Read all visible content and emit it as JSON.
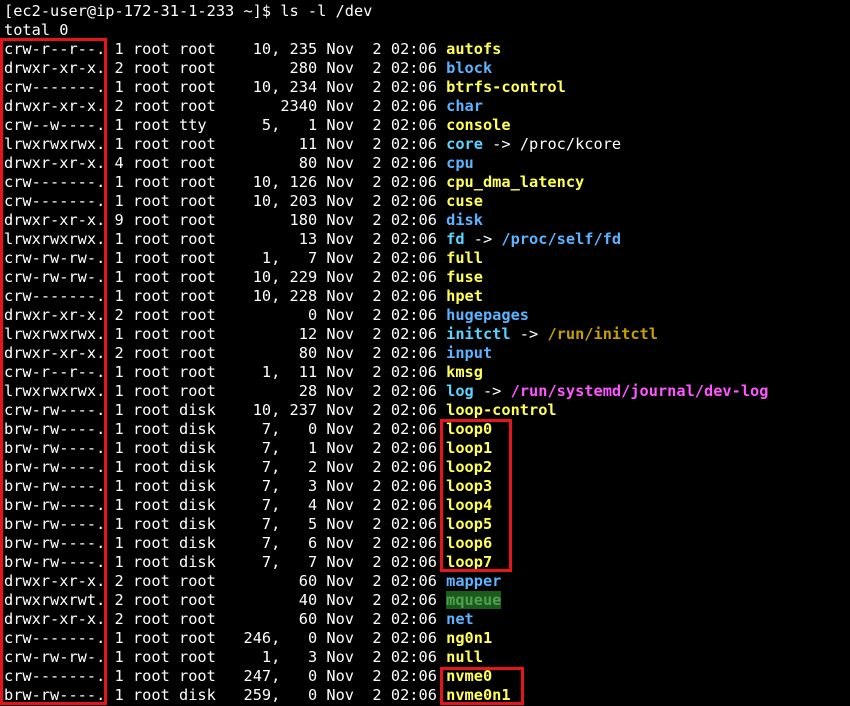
{
  "terminal": {
    "prompt": "[ec2-user@ip-172-31-1-233 ~]$ ls -l /dev",
    "total": "total 0",
    "entries": [
      {
        "perm": "crw-r--r--.",
        "links": "1",
        "owner": "root",
        "group": "root",
        "size": "10, 235",
        "month": "Nov",
        "day": "2",
        "time": "02:06",
        "name": "autofs",
        "kind": "yellow"
      },
      {
        "perm": "drwxr-xr-x.",
        "links": "2",
        "owner": "root",
        "group": "root",
        "size": "280",
        "month": "Nov",
        "day": "2",
        "time": "02:06",
        "name": "block",
        "kind": "blue"
      },
      {
        "perm": "crw-------.",
        "links": "1",
        "owner": "root",
        "group": "root",
        "size": "10, 234",
        "month": "Nov",
        "day": "2",
        "time": "02:06",
        "name": "btrfs-control",
        "kind": "yellow"
      },
      {
        "perm": "drwxr-xr-x.",
        "links": "2",
        "owner": "root",
        "group": "root",
        "size": "2340",
        "month": "Nov",
        "day": "2",
        "time": "02:06",
        "name": "char",
        "kind": "blue"
      },
      {
        "perm": "crw--w----.",
        "links": "1",
        "owner": "root",
        "group": "tty",
        "size": "5,   1",
        "month": "Nov",
        "day": "2",
        "time": "02:06",
        "name": "console",
        "kind": "yellow"
      },
      {
        "perm": "lrwxrwxrwx.",
        "links": "1",
        "owner": "root",
        "group": "root",
        "size": "11",
        "month": "Nov",
        "day": "2",
        "time": "02:06",
        "name": "core",
        "kind": "cyan",
        "arrow": " -> ",
        "target": "/proc/kcore",
        "target_kind": "white"
      },
      {
        "perm": "drwxr-xr-x.",
        "links": "4",
        "owner": "root",
        "group": "root",
        "size": "80",
        "month": "Nov",
        "day": "2",
        "time": "02:06",
        "name": "cpu",
        "kind": "blue"
      },
      {
        "perm": "crw-------.",
        "links": "1",
        "owner": "root",
        "group": "root",
        "size": "10, 126",
        "month": "Nov",
        "day": "2",
        "time": "02:06",
        "name": "cpu_dma_latency",
        "kind": "yellow"
      },
      {
        "perm": "crw-------.",
        "links": "1",
        "owner": "root",
        "group": "root",
        "size": "10, 203",
        "month": "Nov",
        "day": "2",
        "time": "02:06",
        "name": "cuse",
        "kind": "yellow"
      },
      {
        "perm": "drwxr-xr-x.",
        "links": "9",
        "owner": "root",
        "group": "root",
        "size": "180",
        "month": "Nov",
        "day": "2",
        "time": "02:06",
        "name": "disk",
        "kind": "blue"
      },
      {
        "perm": "lrwxrwxrwx.",
        "links": "1",
        "owner": "root",
        "group": "root",
        "size": "13",
        "month": "Nov",
        "day": "2",
        "time": "02:06",
        "name": "fd",
        "kind": "cyan",
        "arrow": " -> ",
        "target": "/proc/self/fd",
        "target_kind": "blue"
      },
      {
        "perm": "crw-rw-rw-.",
        "links": "1",
        "owner": "root",
        "group": "root",
        "size": "1,   7",
        "month": "Nov",
        "day": "2",
        "time": "02:06",
        "name": "full",
        "kind": "yellow"
      },
      {
        "perm": "crw-rw-rw-.",
        "links": "1",
        "owner": "root",
        "group": "root",
        "size": "10, 229",
        "month": "Nov",
        "day": "2",
        "time": "02:06",
        "name": "fuse",
        "kind": "yellow"
      },
      {
        "perm": "crw-------.",
        "links": "1",
        "owner": "root",
        "group": "root",
        "size": "10, 228",
        "month": "Nov",
        "day": "2",
        "time": "02:06",
        "name": "hpet",
        "kind": "yellow"
      },
      {
        "perm": "drwxr-xr-x.",
        "links": "2",
        "owner": "root",
        "group": "root",
        "size": "0",
        "month": "Nov",
        "day": "2",
        "time": "02:06",
        "name": "hugepages",
        "kind": "blue"
      },
      {
        "perm": "lrwxrwxrwx.",
        "links": "1",
        "owner": "root",
        "group": "root",
        "size": "12",
        "month": "Nov",
        "day": "2",
        "time": "02:06",
        "name": "initctl",
        "kind": "cyan",
        "arrow": " -> ",
        "target": "/run/initctl",
        "target_kind": "olive"
      },
      {
        "perm": "drwxr-xr-x.",
        "links": "2",
        "owner": "root",
        "group": "root",
        "size": "80",
        "month": "Nov",
        "day": "2",
        "time": "02:06",
        "name": "input",
        "kind": "blue"
      },
      {
        "perm": "crw-r--r--.",
        "links": "1",
        "owner": "root",
        "group": "root",
        "size": "1,  11",
        "month": "Nov",
        "day": "2",
        "time": "02:06",
        "name": "kmsg",
        "kind": "yellow"
      },
      {
        "perm": "lrwxrwxrwx.",
        "links": "1",
        "owner": "root",
        "group": "root",
        "size": "28",
        "month": "Nov",
        "day": "2",
        "time": "02:06",
        "name": "log",
        "kind": "cyan",
        "arrow": " -> ",
        "target": "/run/systemd/journal/dev-log",
        "target_kind": "magenta"
      },
      {
        "perm": "crw-rw----.",
        "links": "1",
        "owner": "root",
        "group": "disk",
        "size": "10, 237",
        "month": "Nov",
        "day": "2",
        "time": "02:06",
        "name": "loop-control",
        "kind": "yellow"
      },
      {
        "perm": "brw-rw----.",
        "links": "1",
        "owner": "root",
        "group": "disk",
        "size": "7,   0",
        "month": "Nov",
        "day": "2",
        "time": "02:06",
        "name": "loop0",
        "kind": "yellow"
      },
      {
        "perm": "brw-rw----.",
        "links": "1",
        "owner": "root",
        "group": "disk",
        "size": "7,   1",
        "month": "Nov",
        "day": "2",
        "time": "02:06",
        "name": "loop1",
        "kind": "yellow"
      },
      {
        "perm": "brw-rw----.",
        "links": "1",
        "owner": "root",
        "group": "disk",
        "size": "7,   2",
        "month": "Nov",
        "day": "2",
        "time": "02:06",
        "name": "loop2",
        "kind": "yellow"
      },
      {
        "perm": "brw-rw----.",
        "links": "1",
        "owner": "root",
        "group": "disk",
        "size": "7,   3",
        "month": "Nov",
        "day": "2",
        "time": "02:06",
        "name": "loop3",
        "kind": "yellow"
      },
      {
        "perm": "brw-rw----.",
        "links": "1",
        "owner": "root",
        "group": "disk",
        "size": "7,   4",
        "month": "Nov",
        "day": "2",
        "time": "02:06",
        "name": "loop4",
        "kind": "yellow"
      },
      {
        "perm": "brw-rw----.",
        "links": "1",
        "owner": "root",
        "group": "disk",
        "size": "7,   5",
        "month": "Nov",
        "day": "2",
        "time": "02:06",
        "name": "loop5",
        "kind": "yellow"
      },
      {
        "perm": "brw-rw----.",
        "links": "1",
        "owner": "root",
        "group": "disk",
        "size": "7,   6",
        "month": "Nov",
        "day": "2",
        "time": "02:06",
        "name": "loop6",
        "kind": "yellow"
      },
      {
        "perm": "brw-rw----.",
        "links": "1",
        "owner": "root",
        "group": "disk",
        "size": "7,   7",
        "month": "Nov",
        "day": "2",
        "time": "02:06",
        "name": "loop7",
        "kind": "yellow"
      },
      {
        "perm": "drwxr-xr-x.",
        "links": "2",
        "owner": "root",
        "group": "root",
        "size": "60",
        "month": "Nov",
        "day": "2",
        "time": "02:06",
        "name": "mapper",
        "kind": "blue"
      },
      {
        "perm": "drwxrwxrwt.",
        "links": "2",
        "owner": "root",
        "group": "root",
        "size": "40",
        "month": "Nov",
        "day": "2",
        "time": "02:06",
        "name": "mqueue",
        "kind": "mqueue"
      },
      {
        "perm": "drwxr-xr-x.",
        "links": "2",
        "owner": "root",
        "group": "root",
        "size": "60",
        "month": "Nov",
        "day": "2",
        "time": "02:06",
        "name": "net",
        "kind": "blue"
      },
      {
        "perm": "crw-------.",
        "links": "1",
        "owner": "root",
        "group": "root",
        "size": "246,   0",
        "month": "Nov",
        "day": "2",
        "time": "02:06",
        "name": "ng0n1",
        "kind": "yellow"
      },
      {
        "perm": "crw-rw-rw-.",
        "links": "1",
        "owner": "root",
        "group": "root",
        "size": "1,   3",
        "month": "Nov",
        "day": "2",
        "time": "02:06",
        "name": "null",
        "kind": "yellow"
      },
      {
        "perm": "crw-------.",
        "links": "1",
        "owner": "root",
        "group": "root",
        "size": "247,   0",
        "month": "Nov",
        "day": "2",
        "time": "02:06",
        "name": "nvme0",
        "kind": "yellow"
      },
      {
        "perm": "brw-rw----.",
        "links": "1",
        "owner": "root",
        "group": "disk",
        "size": "259,   0",
        "month": "Nov",
        "day": "2",
        "time": "02:06",
        "name": "nvme0n1",
        "kind": "yellow"
      }
    ]
  },
  "colors": {
    "background": "#000000",
    "text": "#ffffff",
    "device": "#ffff55",
    "directory": "#5cb3ff",
    "symlink": "#5cd3ff",
    "highlight_box": "#e8141c"
  }
}
